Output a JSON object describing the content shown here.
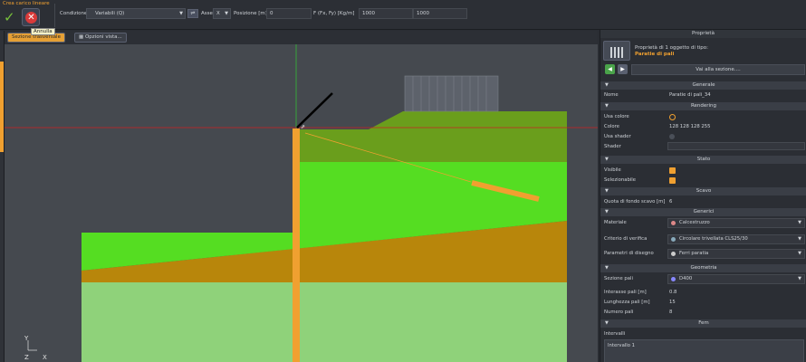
{
  "toolbar": {
    "command_title": "Crea carico lineare",
    "cancel_tooltip": "Annulla",
    "condizione_label": "Condizione",
    "condizione_value": "Variabili (Q)",
    "asse_label": "Asse",
    "asse_value": "X",
    "posizione_label": "Posizione [m]",
    "posizione_value": "0",
    "forza_label": "F (Fx, Fy) [Kg/m]",
    "fx_value": "1000",
    "fy_value": "1000"
  },
  "subtoolbar": {
    "section_tab": "Sezione trasversale",
    "view_options": "Opzioni vista..."
  },
  "viewport": {
    "axis_labels": {
      "y": "Y",
      "z": "Z",
      "x": "X"
    },
    "colors": {
      "background": "#45494f",
      "upper_soil": "#6a9e1c",
      "bright_soil": "#55dd22",
      "brown_soil": "#b8860b",
      "lower_soil": "#8fd27a",
      "pile": "#f0a030",
      "axis_green": "#33cc33",
      "axis_red": "#cc2222"
    }
  },
  "panel": {
    "title": "Proprietà",
    "object_line1": "Proprietà di 1 oggetto di tipo:",
    "object_type": "Paratie di pali",
    "goto_label": "Vai alla sezione....",
    "sections": {
      "generale": "Generale",
      "rendering": "Rendering",
      "stato": "Stato",
      "scavo": "Scavo",
      "generici": "Generici",
      "geometria": "Geometria",
      "fem": "Fem"
    },
    "nome_label": "Nome",
    "nome_value": "Paratie di pali_34",
    "usa_colore_label": "Usa colore",
    "colore_label": "Colore",
    "colore_value": "128 128 128 255",
    "usa_shader_label": "Usa shader",
    "shader_label": "Shader",
    "visibile_label": "Visibile",
    "selezionabile_label": "Selezionabile",
    "quota_label": "Quota di fondo scavo [m]",
    "quota_value": "6",
    "materiale_label": "Materiale",
    "materiale_value": "Calcestruzzo",
    "criterio_label": "Criterio di verifica",
    "criterio_value": "Circolare trivellata CLS25/30",
    "parametri_label": "Parametri di disegno",
    "parametri_value": "Ferri paratia",
    "sezione_label": "Sezione pali",
    "sezione_value": "D400",
    "interasse_label": "Interasse pali [m]",
    "interasse_value": "0.8",
    "lunghezza_label": "Lunghezza pali [m]",
    "lunghezza_value": "15",
    "numero_label": "Numero pali",
    "numero_value": "8",
    "intervalli_label": "Intervalli",
    "intervalli_value": "Intervallo 1"
  }
}
